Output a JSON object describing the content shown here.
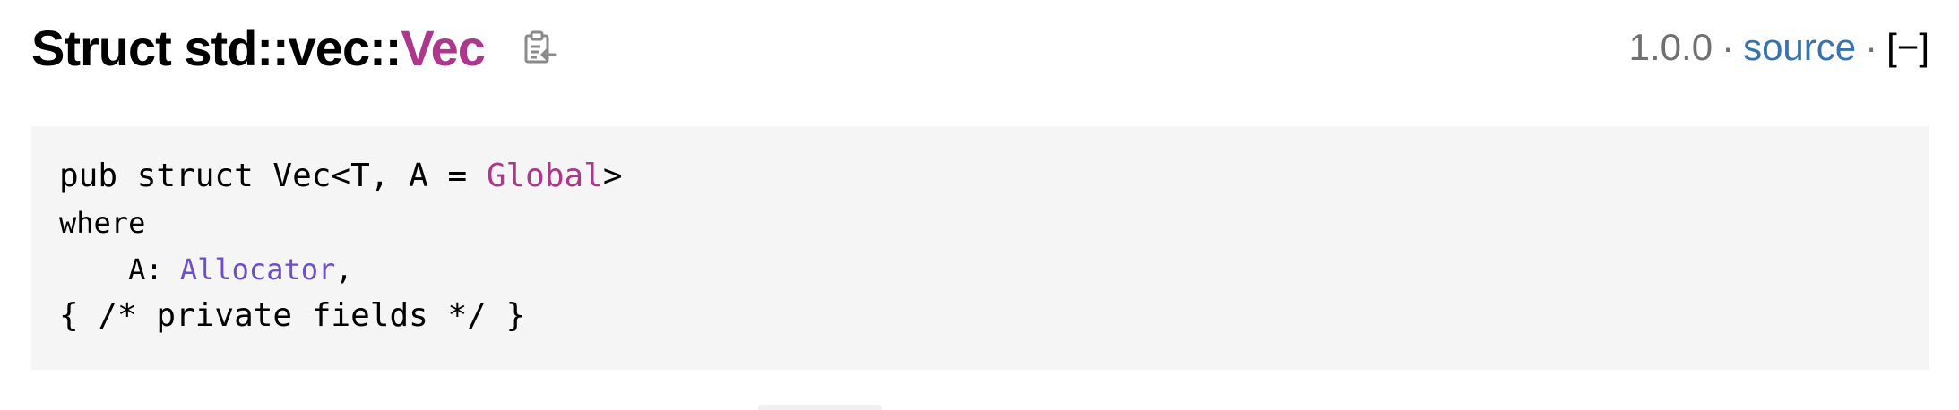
{
  "heading": {
    "prefix": "Struct std::vec::",
    "name": "Vec",
    "copy_icon": "copy-path-icon"
  },
  "out_of_band": {
    "version": "1.0.0",
    "separator": "·",
    "source_label": "source",
    "toggle_label": "[−]"
  },
  "declaration": {
    "line1_prefix": "pub struct Vec<T, A = ",
    "line1_type": "Global",
    "line1_suffix": ">",
    "line2": "where",
    "line3_prefix": "    A: ",
    "line3_trait": "Allocator",
    "line3_suffix": ",",
    "line4": "{ /* private fields */ }"
  },
  "colors": {
    "struct_name": "#ad378a",
    "type_link": "#ad378a",
    "trait_link": "#6e4fc9",
    "source_link": "#3873ad",
    "version_text": "#707070",
    "code_background": "#f5f5f5"
  }
}
